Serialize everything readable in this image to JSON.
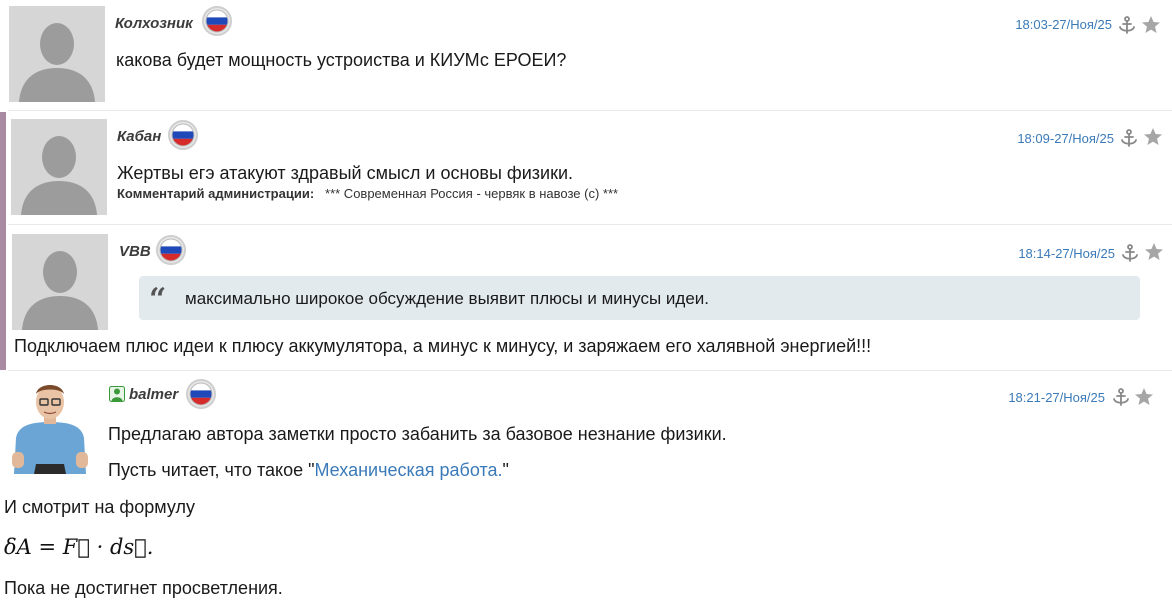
{
  "comments": [
    {
      "author": "Колхозник",
      "time": "18:03-27/Ноя/25",
      "text": "какова будет мощность устроиства и КИУМс ЕРОЕИ?"
    },
    {
      "author": "Кабан",
      "time": "18:09-27/Ноя/25",
      "text": "Жертвы егэ атакуют здравый смысл и основы физики.",
      "admin_label": "Комментарий администрации:",
      "admin_text": "*** Современная Россия - червяк в навозе (с) ***"
    },
    {
      "author": "VBB",
      "time": "18:14-27/Ноя/25",
      "quote_mark": "“",
      "quote": "максимально широкое обсуждение выявит плюсы и минусы идеи.",
      "text": "Подключаем плюс идеи к плюсу аккумулятора, а минус к минусу, и заряжаем его халявной энергией!!!"
    },
    {
      "author": "balmer",
      "time": "18:21-27/Ноя/25",
      "line1": "Предлагаю автора заметки просто забанить за базовое незнание физики.",
      "line2_prefix": "Пусть читает, что такое \"",
      "line2_link": "Механическая работа.",
      "line2_suffix": "\"",
      "line3": "И смотрит на формулу",
      "formula": "δA = F⃗ · ds⃗.",
      "line4": "Пока не достигнет просветления."
    }
  ],
  "icons": {
    "anchor": "anchor-icon",
    "star": "star-icon",
    "flag": "russia-flag-icon",
    "avatar": "default-avatar-icon",
    "user": "user-badge-icon"
  },
  "colors": {
    "link": "#3b7ab8",
    "quote_bg": "#e3eaee",
    "thread_bar": "#a88aa2",
    "badge_green": "#3a9a3a"
  }
}
